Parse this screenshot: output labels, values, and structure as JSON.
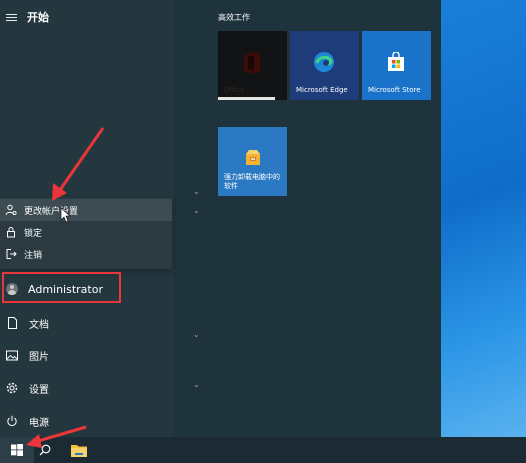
{
  "start_menu": {
    "title": "开始"
  },
  "account_flyout": {
    "items": [
      {
        "label": "更改帐户设置",
        "icon": "person-settings-icon"
      },
      {
        "label": "锁定",
        "icon": "lock-icon"
      },
      {
        "label": "注销",
        "icon": "sign-out-icon"
      }
    ]
  },
  "user": {
    "name": "Administrator",
    "icon": "user-avatar-icon"
  },
  "rail": {
    "documents": "文档",
    "pictures": "图片",
    "settings": "设置",
    "power": "电源"
  },
  "tiles": {
    "group_title": "高效工作",
    "office": "Office",
    "edge": "Microsoft Edge",
    "store": "Microsoft Store",
    "uninstall": "强力卸载电脑中的软件"
  },
  "colors": {
    "annotation_red": "#e8363a",
    "tile_blue": "#1a73c8",
    "desktop_blue": "#1a7fd8"
  }
}
